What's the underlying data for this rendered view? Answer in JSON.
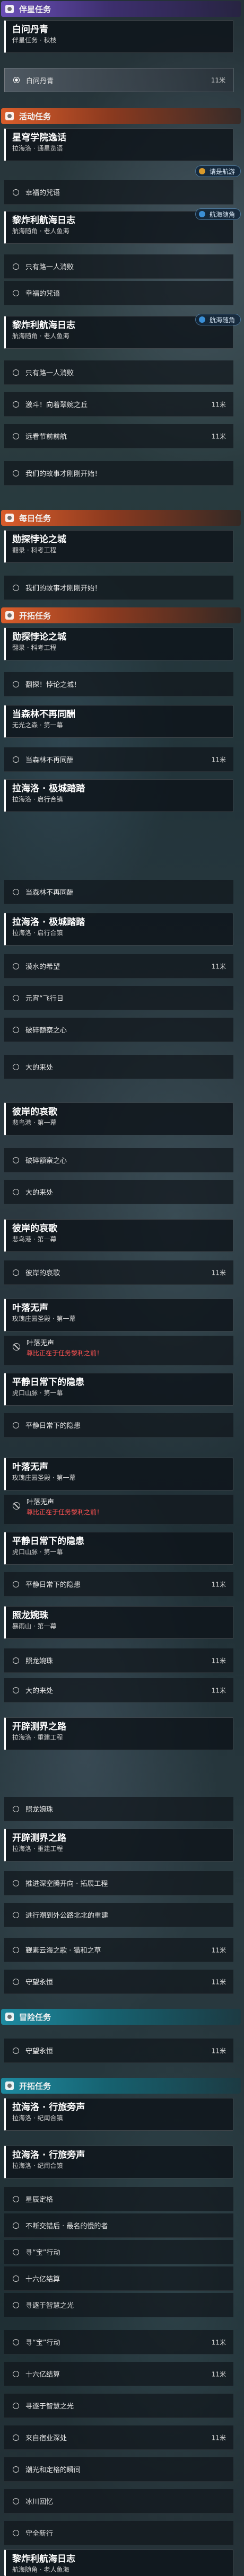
{
  "sections": {
    "companion": "伴星任务",
    "event": "活动任务",
    "daily": "每日任务",
    "trailblaze": "开拓任务",
    "adventure": "冒险任务",
    "trailblaze2": "开拓任务"
  },
  "quests": {
    "q1": {
      "title": "白问丹青",
      "subtitle": "伴星任务 · 秋枝"
    },
    "q2": {
      "title": "星穹学院逸话",
      "subtitle": "拉海洛 · 通星览语"
    },
    "q3": {
      "title": "黎炸利航海日志",
      "subtitle": "航海随角 · 老人鱼海"
    },
    "q4": {
      "title": "黎炸利航海日志",
      "subtitle": "航海随角 · 老人鱼海"
    },
    "q5": {
      "title": "勋探悖论之城",
      "subtitle": "翻录 · 科考工程"
    },
    "q6": {
      "title": "勋探悖论之城",
      "subtitle": "翻录 · 科考工程"
    },
    "q7": {
      "title": "当森林不再同酬",
      "subtitle": "无光之森 · 第一幕"
    },
    "q8": {
      "title": "拉海洛 · 极城踏踏",
      "subtitle": "拉海洛 · 启行合镇"
    },
    "q9": {
      "title": "拉海洛 · 极城踏踏",
      "subtitle": "拉海洛 · 启行合镇"
    },
    "q10": {
      "title": "彼岸的哀歌",
      "subtitle": "悲鸟港 · 第一幕"
    },
    "q11": {
      "title": "彼岸的哀歌",
      "subtitle": "悲鸟港 · 第一幕"
    },
    "q12": {
      "title": "叶落无声",
      "subtitle": "玫瑰庄园圣殿 · 第一幕"
    },
    "q13": {
      "title": "平静日常下的隐患",
      "subtitle": "虎口山脉 · 第一幕"
    },
    "q14": {
      "title": "叶落无声",
      "subtitle": "玫瑰庄园圣殿 · 第一幕"
    },
    "q15": {
      "title": "平静日常下的隐患",
      "subtitle": "虎口山脉 · 第一幕"
    },
    "q16": {
      "title": "照龙婉珠",
      "subtitle": "暴雨山 · 第一幕"
    },
    "q17": {
      "title": "开辟测界之路",
      "subtitle": "拉海洛 · 重建工程"
    },
    "q18": {
      "title": "开辟测界之路",
      "subtitle": "拉海洛 · 重建工程"
    },
    "q19": {
      "title": "拉海洛 · 行旅旁声",
      "subtitle": "拉海洛 · 纪闻合镇"
    },
    "q20": {
      "title": "拉海洛 · 行旅旁声",
      "subtitle": "拉海洛 · 纪闻合镇"
    },
    "q21": {
      "title": "黎炸利航海日志",
      "subtitle": "航海随角 · 老人鱼海"
    }
  },
  "objectives": {
    "o1": {
      "text": "白问丹青",
      "distance": "11米"
    },
    "o2": {
      "text": "幸福的咒语"
    },
    "o3": {
      "text": "只有路一人消败"
    },
    "o4": {
      "text": "幸福的咒语"
    },
    "o5": {
      "text": "只有路一人消败"
    },
    "o6": {
      "text": "激斗！向着翠婉之丘",
      "distance": "11米"
    },
    "o7": {
      "text": "远看节前前航",
      "distance": "11米"
    },
    "o8": {
      "text": "我们的故事才刚刚开始！"
    },
    "o9": {
      "text": "我们的故事才刚刚开始！"
    },
    "o10": {
      "text": "翻探！悖论之城！"
    },
    "o11": {
      "text": "当森林不再同酬",
      "distance": "11米"
    },
    "o12": {
      "text": "当森林不再同酬"
    },
    "o13": {
      "text": "漠水的希望",
      "distance": "11米"
    },
    "o14": {
      "text": "元宵“飞行日"
    },
    "o15": {
      "text": "破碎额察之心"
    },
    "o16": {
      "text": "大的来处"
    },
    "o17": {
      "text": "破碎额察之心"
    },
    "o18": {
      "text": "大的来处"
    },
    "o19": {
      "text": "彼岸的哀歌",
      "distance": "11米"
    },
    "o20": {
      "text": "平静日常下的隐患"
    },
    "o21": {
      "text": "平静日常下的隐患",
      "distance": "11米"
    },
    "o22": {
      "text": "照龙婉珠",
      "distance": "11米"
    },
    "o23": {
      "text": "大的来处",
      "distance": "11米"
    },
    "o24": {
      "text": "照龙婉珠"
    },
    "o25": {
      "text": "推进深空腾开向 · 拓展工程"
    },
    "o26": {
      "text": "进行潮到外公路北北的重建"
    },
    "o27": {
      "text": "觐素云海之歌 · 猫和之草",
      "distance": "11米"
    },
    "o28": {
      "text": "守望永恒",
      "distance": "11米"
    },
    "o29": {
      "text": "守望永恒",
      "distance": "11米"
    },
    "o30": {
      "text": "星辰定格"
    },
    "o31": {
      "text": "不断交错后 · 最名的慢的者"
    },
    "o32": {
      "text": "寻“宝”行动"
    },
    "o33": {
      "text": "十六亿结算"
    },
    "o34": {
      "text": "寻逐于智慧之光"
    },
    "o35": {
      "text": "寻“宝”行动",
      "distance": "11米"
    },
    "o36": {
      "text": "十六亿结算",
      "distance": "11米"
    },
    "o37": {
      "text": "寻逐于智慧之光"
    },
    "o38": {
      "text": "来自宿业深处",
      "distance": "11米"
    },
    "o39": {
      "text": "潮光和定格的瞬间"
    },
    "o40": {
      "text": "冰川回忆"
    },
    "o41": {
      "text": "守全新行"
    }
  },
  "locked": {
    "l1": {
      "text": "叶落无声",
      "reason": "尊比正在于任务黎利之前！"
    },
    "l2": {
      "text": "叶落无声",
      "reason": "尊比正在于任务黎利之前！"
    }
  },
  "chips": {
    "c1": "请是航游",
    "c2": "航海随角",
    "c3": "航海随角"
  }
}
